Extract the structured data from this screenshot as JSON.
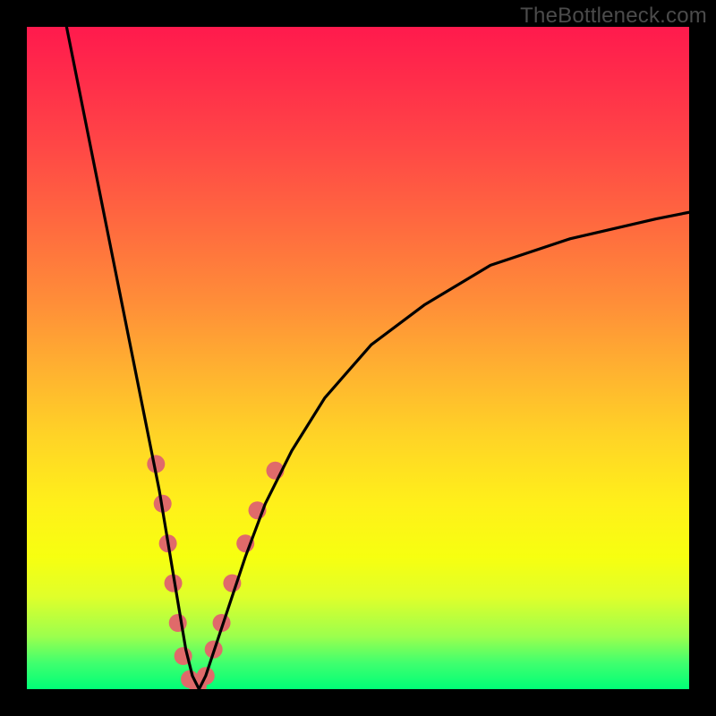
{
  "watermark": "TheBottleneck.com",
  "chart_data": {
    "type": "line",
    "title": "",
    "xlabel": "",
    "ylabel": "",
    "xlim": [
      0,
      100
    ],
    "ylim": [
      0,
      100
    ],
    "series": [
      {
        "name": "bottleneck-curve",
        "x": [
          6,
          8,
          10,
          12,
          14,
          16,
          18,
          20,
          21,
          22,
          23,
          24,
          25,
          26,
          27,
          28,
          30,
          33,
          36,
          40,
          45,
          52,
          60,
          70,
          82,
          95,
          100
        ],
        "y": [
          100,
          90,
          80,
          70,
          60,
          50,
          40,
          30,
          24,
          18,
          12,
          6,
          2,
          0,
          2,
          5,
          11,
          20,
          28,
          36,
          44,
          52,
          58,
          64,
          68,
          71,
          72
        ]
      }
    ],
    "markers": {
      "name": "highlighted-points",
      "color": "#e06a6a",
      "points": [
        {
          "x": 19.5,
          "y": 34,
          "r": 10
        },
        {
          "x": 20.5,
          "y": 28,
          "r": 10
        },
        {
          "x": 21.3,
          "y": 22,
          "r": 10
        },
        {
          "x": 22.1,
          "y": 16,
          "r": 10
        },
        {
          "x": 22.8,
          "y": 10,
          "r": 10
        },
        {
          "x": 23.6,
          "y": 5,
          "r": 10
        },
        {
          "x": 24.6,
          "y": 1.5,
          "r": 10
        },
        {
          "x": 25.8,
          "y": 0.5,
          "r": 10
        },
        {
          "x": 27.0,
          "y": 2,
          "r": 10
        },
        {
          "x": 28.2,
          "y": 6,
          "r": 10
        },
        {
          "x": 29.4,
          "y": 10,
          "r": 10
        },
        {
          "x": 31.0,
          "y": 16,
          "r": 10
        },
        {
          "x": 33.0,
          "y": 22,
          "r": 10
        },
        {
          "x": 34.8,
          "y": 27,
          "r": 10
        },
        {
          "x": 37.5,
          "y": 33,
          "r": 10
        }
      ]
    }
  }
}
